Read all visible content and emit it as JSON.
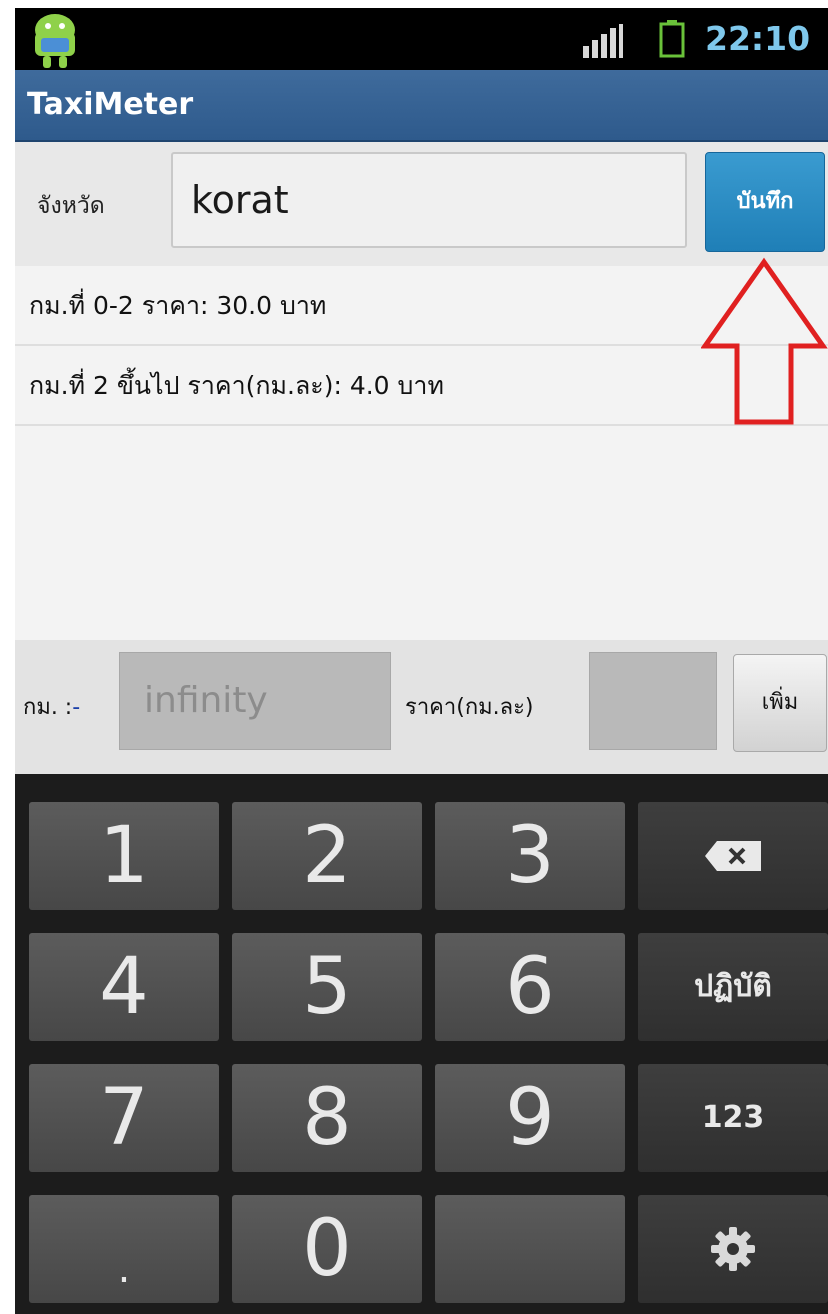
{
  "status_bar": {
    "time": "22:10",
    "app_icon": "android-icon",
    "signal_icon": "signal-bars-icon",
    "battery_icon": "battery-icon"
  },
  "action_bar": {
    "title": "TaxiMeter"
  },
  "province": {
    "label": "จังหวัด",
    "value": "korat",
    "save_label": "บันทึก"
  },
  "rates": [
    "กม.ที่ 0-2 ราคา: 30.0 บาท",
    "กม.ที่ 2 ขึ้นไป ราคา(กม.ละ): 4.0 บาท"
  ],
  "annotation": {
    "arrow_color": "#e02020"
  },
  "add_row": {
    "km_label": "กม. :",
    "km_dash": "-",
    "km_placeholder": "infinity",
    "price_label": "ราคา(กม.ละ)",
    "price_value": "",
    "add_label": "เพิ่ม"
  },
  "keyboard": {
    "keys": {
      "k1": "1",
      "k2": "2",
      "k3": "3",
      "k4": "4",
      "k5": "5",
      "k6": "6",
      "k7": "7",
      "k8": "8",
      "k9": "9",
      "dot": ".",
      "k0": "0",
      "done": "ปฏิบัติ",
      "mode": "123"
    },
    "icons": [
      "backspace-icon",
      "settings-gear-icon"
    ]
  },
  "colors": {
    "action_bar": "#2e5a8c",
    "save_button": "#1f7fb7",
    "clock": "#7fc8ec"
  }
}
